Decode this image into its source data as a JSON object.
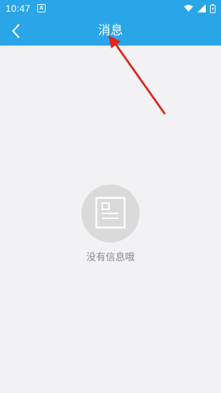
{
  "status_bar": {
    "time": "10:47",
    "notification_icon": "a-letter-icon",
    "icons": [
      "wifi-icon",
      "cellular-signal-icon",
      "battery-icon"
    ]
  },
  "header": {
    "title": "消息",
    "back_icon": "chevron-left-icon",
    "background_color": "#2aa6e8"
  },
  "empty_state": {
    "icon": "document-icon",
    "message": "没有信息哦"
  },
  "annotation": {
    "arrow_color": "#e0241f"
  }
}
